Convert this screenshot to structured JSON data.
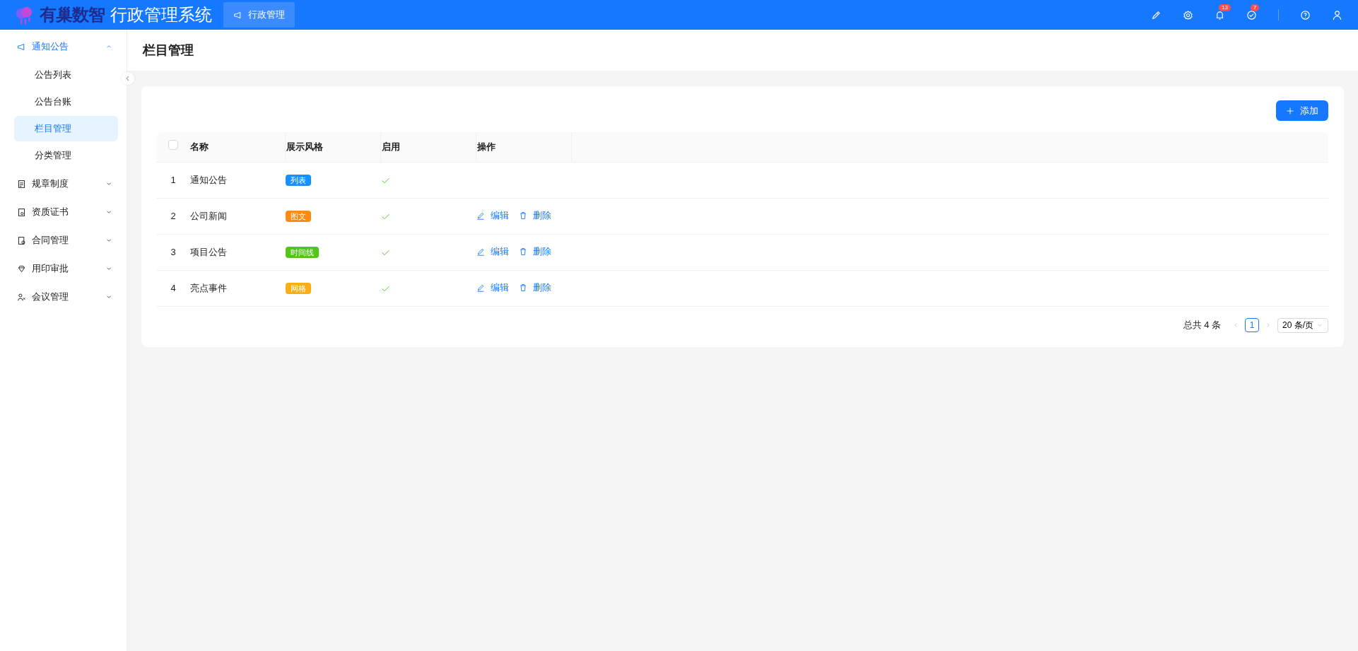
{
  "header": {
    "logo_text": "有巢数智",
    "app_title": "行政管理系统",
    "module_tab": {
      "label": "行政管理",
      "selected": true
    },
    "icons": [
      {
        "kind": "brush"
      },
      {
        "kind": "gear"
      },
      {
        "kind": "bell",
        "badge": "13"
      },
      {
        "kind": "check",
        "badge": "7"
      },
      {
        "kind": "divider"
      },
      {
        "kind": "help"
      },
      {
        "kind": "user"
      }
    ]
  },
  "sidebar": {
    "items": [
      {
        "label": "通知公告",
        "expanded": true,
        "children": [
          {
            "label": "公告列表",
            "selected": false
          },
          {
            "label": "公告台账",
            "selected": false
          },
          {
            "label": "栏目管理",
            "selected": true
          },
          {
            "label": "分类管理",
            "selected": false
          }
        ]
      },
      {
        "label": "规章制度",
        "expanded": false
      },
      {
        "label": "资质证书",
        "expanded": false
      },
      {
        "label": "合同管理",
        "expanded": false
      },
      {
        "label": "用印审批",
        "expanded": false
      },
      {
        "label": "会议管理",
        "expanded": false
      }
    ]
  },
  "page_title": "栏目管理",
  "add_button": "添加",
  "table": {
    "select_all_checked": false,
    "columns": [
      "名称",
      "展示风格",
      "启用",
      "操作"
    ],
    "rows": [
      {
        "index": "1",
        "name": "通知公告",
        "style": {
          "label": "列表",
          "color": "#1890ff"
        },
        "enabled": true
      },
      {
        "index": "2",
        "name": "公司新闻",
        "style": {
          "label": "图文",
          "color": "#fa8c16"
        },
        "enabled": true,
        "actions": [
          {
            "kind": "edit",
            "label": "编辑"
          },
          {
            "kind": "delete",
            "label": "删除"
          }
        ]
      },
      {
        "index": "3",
        "name": "项目公告",
        "style": {
          "label": "时间线",
          "color": "#52c41a"
        },
        "enabled": true,
        "actions": [
          {
            "kind": "edit",
            "label": "编辑"
          },
          {
            "kind": "delete",
            "label": "删除"
          }
        ]
      },
      {
        "index": "4",
        "name": "亮点事件",
        "style": {
          "label": "网格",
          "color": "#faad14"
        },
        "enabled": true,
        "actions": [
          {
            "kind": "edit",
            "label": "编辑"
          },
          {
            "kind": "delete",
            "label": "删除"
          }
        ]
      }
    ]
  },
  "pagination": {
    "total": "总共 4 条",
    "pages": [
      {
        "label": "1",
        "selected": true
      }
    ],
    "page_size": "20 条/页"
  }
}
